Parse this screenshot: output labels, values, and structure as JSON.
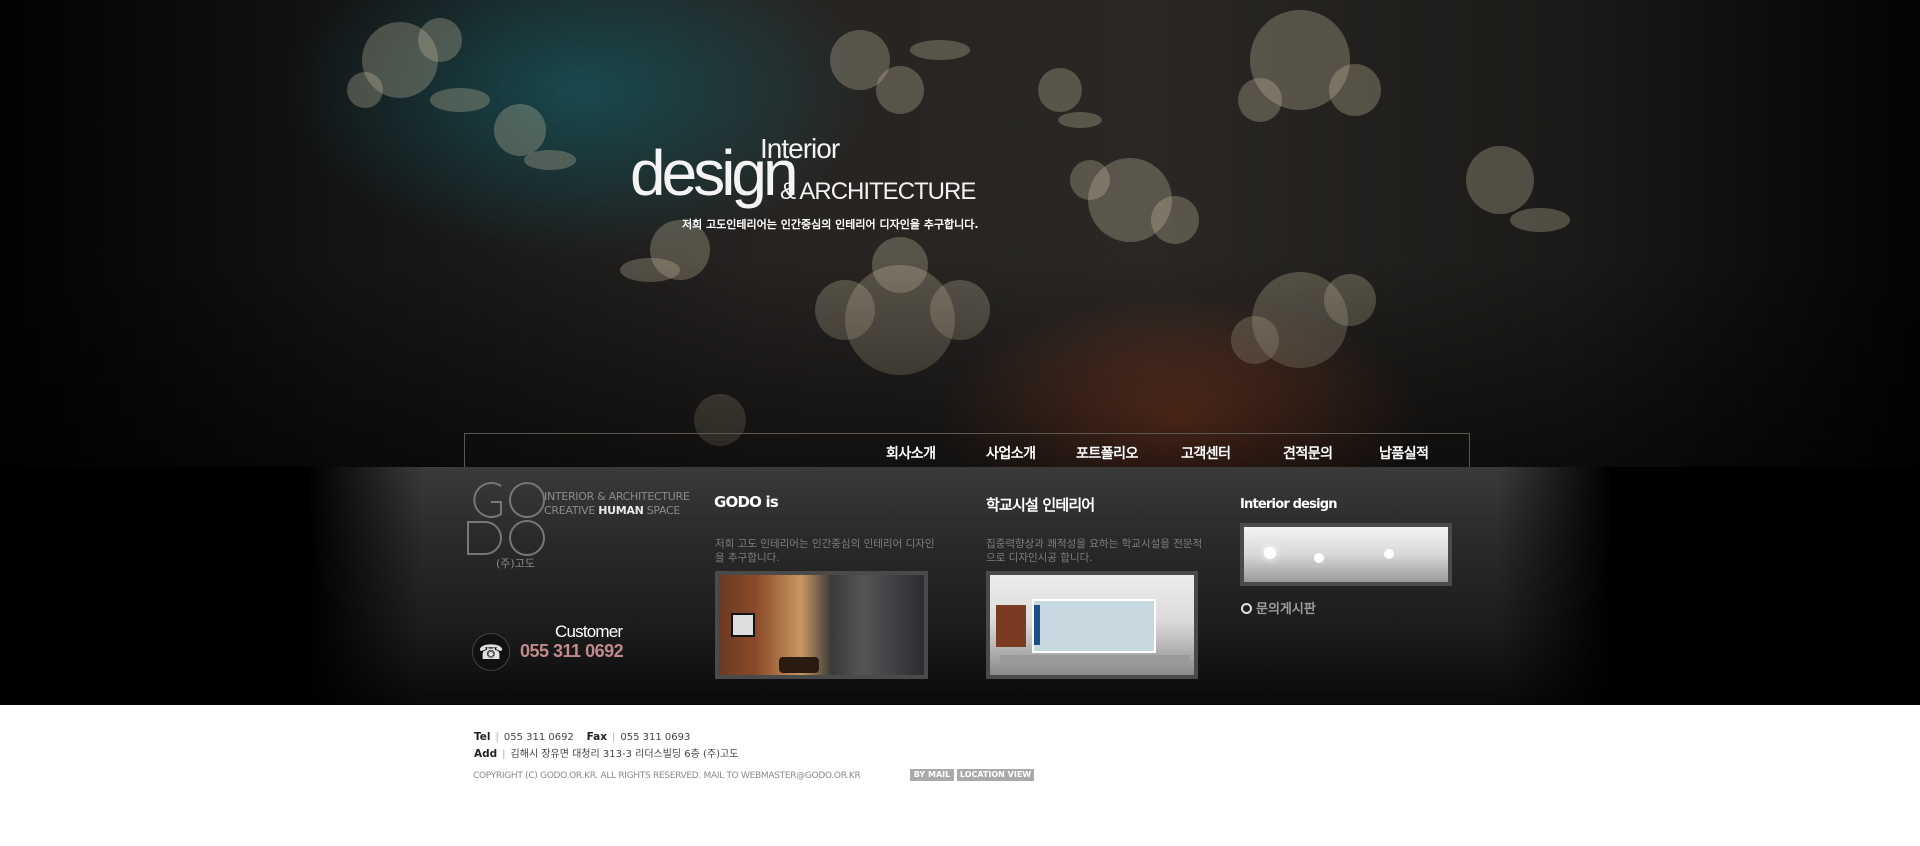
{
  "hero": {
    "heading_small": "Interior",
    "heading_big": "design",
    "heading_arch": "& ARCHITECTURE",
    "description": "저희 고도인테리어는 인간중심의 인테리어 디자인을 추구합니다."
  },
  "nav": {
    "items": [
      {
        "label": "회사소개"
      },
      {
        "label": "사업소개"
      },
      {
        "label": "포트폴리오"
      },
      {
        "label": "고객센터"
      },
      {
        "label": "견적문의"
      },
      {
        "label": "납품실적"
      }
    ]
  },
  "brand": {
    "logo_letters": "GO DO",
    "slogan_line1": "INTERIOR & ARCHITECTURE",
    "slogan_line2_pre": "CREATIVE",
    "slogan_line2_highlight": "HUMAN",
    "slogan_line2_post": "SPACE",
    "company": "(주)고도"
  },
  "customer": {
    "label": "Customer",
    "phone": "055 311 0692"
  },
  "columns": [
    {
      "title": "GODO is",
      "desc": "저희 고도 인테리어는 인간중심의 인테리어 디자인을 추구합니다."
    },
    {
      "title": "학교시설 인테리어",
      "desc": "집중력향상과 쾌적성을 요하는 학교시설을 전문적으로 디자인시공 합니다."
    },
    {
      "title": "Interior design",
      "desc": ""
    }
  ],
  "board_link": "문의게시판",
  "footer": {
    "tel_label": "Tel",
    "tel": "055 311 0692",
    "fax_label": "Fax",
    "fax": "055 311 0693",
    "add_label": "Add",
    "address": "김해시 장유면 대청리 313-3 리더스빌딩 6층 (주)고도",
    "copyright": "COPYRIGHT (C) GODO.OR.KR. ALL RIGHTS RESERVED. MAIL TO WEBMASTER@GODO.OR.KR",
    "btn_mail": "BY MAIL",
    "btn_location": "LOCATION VIEW"
  },
  "icons": [
    "flower-pattern",
    "phone-icon",
    "circle-bullet-icon"
  ]
}
